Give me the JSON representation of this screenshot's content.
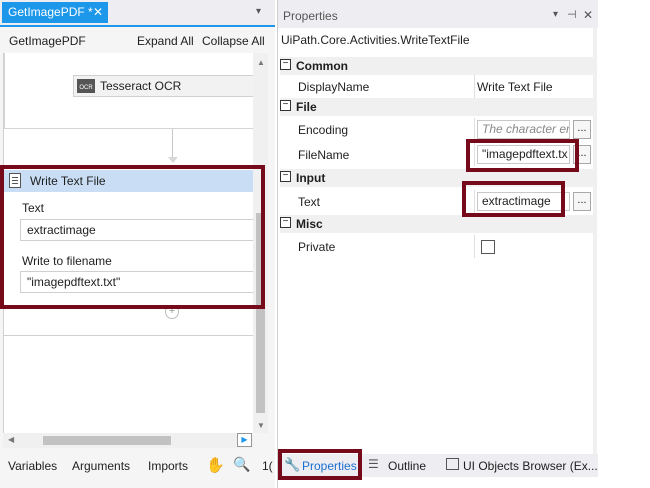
{
  "designer": {
    "tab_label": "GetImagePDF *",
    "tab_close": "✕",
    "tab_dropdown": "▾",
    "workflow_name": "GetImagePDF",
    "expand_all": "Expand All",
    "collapse_all": "Collapse All",
    "ocr_activity": {
      "icon_text": "OCR",
      "label": "Tesseract OCR"
    },
    "write_activity": {
      "title": "Write Text File",
      "text_label": "Text",
      "text_value": "extractimage",
      "filename_label": "Write to filename",
      "filename_value": "\"imagepdftext.txt\""
    },
    "add_glyph": "+",
    "bottom_bar": {
      "variables": "Variables",
      "arguments": "Arguments",
      "imports": "Imports",
      "zoom_level": "1("
    }
  },
  "properties": {
    "title": "Properties",
    "class_name": "UiPath.Core.Activities.WriteTextFile",
    "categories": [
      {
        "toggle": "−",
        "name": "Common",
        "rows": [
          {
            "name": "DisplayName",
            "value": "Write Text File"
          }
        ]
      },
      {
        "toggle": "−",
        "name": "File",
        "rows": [
          {
            "name": "Encoding",
            "placeholder": "The character enc",
            "button": "..."
          },
          {
            "name": "FileName",
            "value": "\"imagepdftext.tx",
            "button": "..."
          }
        ]
      },
      {
        "toggle": "−",
        "name": "Input",
        "rows": [
          {
            "name": "Text",
            "value": "extractimage",
            "button": "..."
          }
        ]
      },
      {
        "toggle": "−",
        "name": "Misc",
        "rows": [
          {
            "name": "Private",
            "checked": false
          }
        ]
      }
    ],
    "bottom_tabs": {
      "properties": "Properties",
      "outline": "Outline",
      "ui_objects": "UI Objects Browser (Ex..."
    }
  },
  "colors": {
    "accent": "#1c97ea",
    "highlight": "#76091a",
    "activity_header": "#c9def5"
  }
}
